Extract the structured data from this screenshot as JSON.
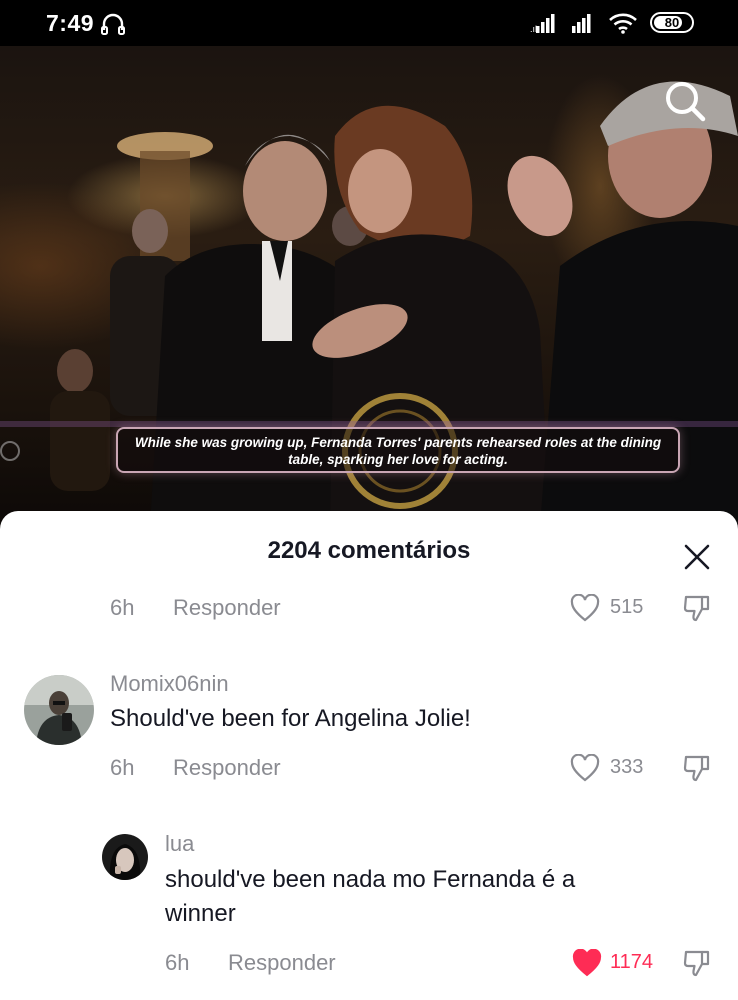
{
  "status_bar": {
    "time": "7:49",
    "battery": "80"
  },
  "video": {
    "caption": "While she was growing up, Fernanda Torres' parents rehearsed roles at the dining table, sparking her love for acting."
  },
  "comments_sheet": {
    "title": "2204 comentários",
    "top_comment_meta": {
      "age": "6h",
      "reply_label": "Responder",
      "likes": "515"
    },
    "comments": [
      {
        "username": "Momix06nin",
        "text": "Should've been for Angelina Jolie!",
        "age": "6h",
        "reply_label": "Responder",
        "likes": "333",
        "liked": false
      }
    ],
    "replies": [
      {
        "username": "lua",
        "text_line1": "should've been nada mo Fernanda é a",
        "text_line2": "winner",
        "age": "6h",
        "reply_label": "Responder",
        "likes": "1174",
        "liked": true
      }
    ]
  },
  "colors": {
    "like_active": "#fe2c55",
    "muted_text": "#8a8b91",
    "primary_text": "#161823"
  }
}
